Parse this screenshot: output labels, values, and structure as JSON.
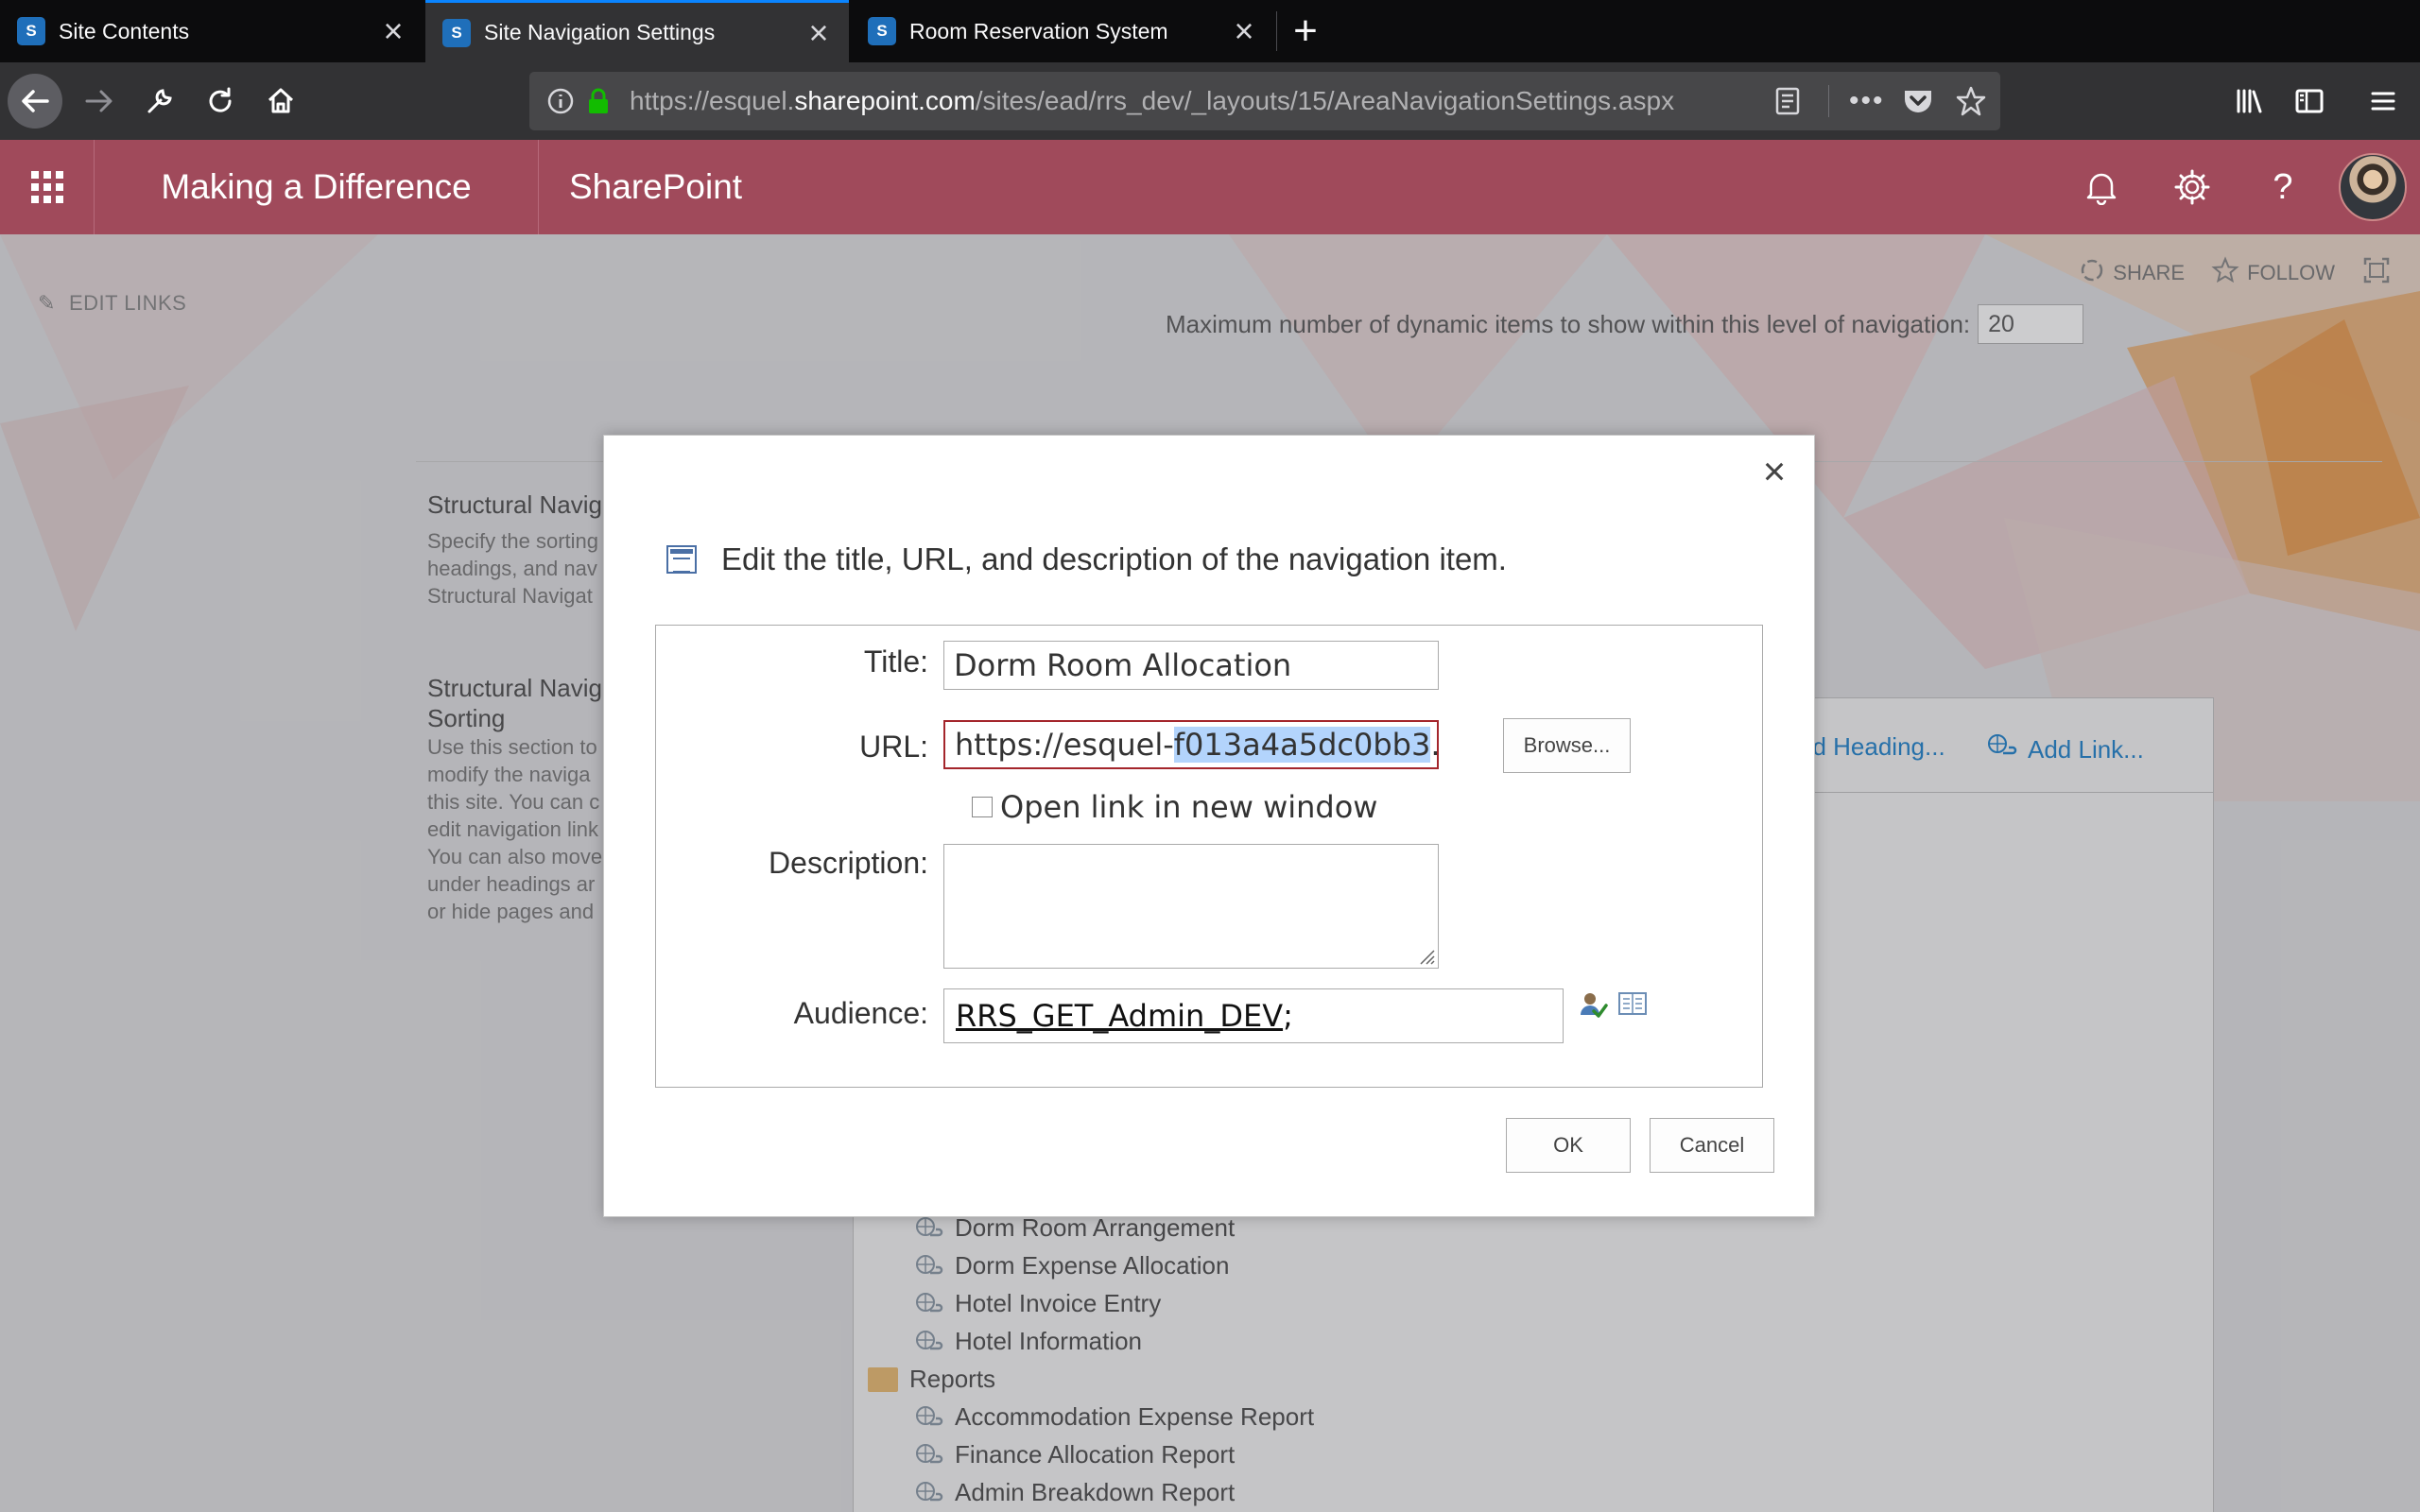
{
  "browser": {
    "tabs": [
      {
        "title": "Site Contents",
        "favicon": "sharepoint-icon"
      },
      {
        "title": "Site Navigation Settings",
        "favicon": "sharepoint-icon"
      },
      {
        "title": "Room Reservation System",
        "favicon": "sharepoint-icon"
      }
    ],
    "url": {
      "prefix": "https://esquel.",
      "domain": "sharepoint.com",
      "path": "/sites/ead/rrs_dev/_layouts/15/AreaNavigationSettings.aspx"
    },
    "accent": "#0a84ff"
  },
  "suitebar": {
    "site_name": "Making a Difference",
    "app_name": "SharePoint",
    "color": "#a04a5b"
  },
  "page": {
    "share_label": "SHARE",
    "follow_label": "FOLLOW",
    "edit_links_label": "EDIT LINKS",
    "max_items_label": "Maximum number of dynamic items to show within this level of navigation:",
    "max_items_value": "20",
    "structural_nav_title": "Structural Navig",
    "structural_nav_desc": [
      "Specify the sorting",
      "headings, and nav",
      "Structural Navigat"
    ],
    "sorting_title_1": "Structural Navig",
    "sorting_title_2": "Sorting",
    "sorting_desc": [
      "Use this section to",
      "modify the naviga",
      "this site. You can c",
      "edit navigation link",
      "You can also move",
      "under headings ar",
      "or hide pages and"
    ],
    "add_heading_label": "dd Heading...",
    "add_link_label": "Add Link...",
    "tree": {
      "items": [
        {
          "label": "Dorm Room Arrangement",
          "kind": "link"
        },
        {
          "label": "Dorm Expense Allocation",
          "kind": "link"
        },
        {
          "label": "Hotel Invoice Entry",
          "kind": "link"
        },
        {
          "label": "Hotel Information",
          "kind": "link"
        },
        {
          "label": "Reports",
          "kind": "heading"
        },
        {
          "label": "Accommodation Expense Report",
          "kind": "link"
        },
        {
          "label": "Finance Allocation Report",
          "kind": "link"
        },
        {
          "label": "Admin Breakdown Report",
          "kind": "link"
        }
      ]
    }
  },
  "dialog": {
    "heading": "Edit the title, URL, and description of the navigation item.",
    "title_label": "Title:",
    "title_value": "Dorm Room Allocation",
    "url_label": "URL:",
    "url_value_pre": "https://esquel-",
    "url_value_sel": "f013a4a5dc0bb3",
    "url_value_post": ".sha",
    "browse_label": "Browse...",
    "new_window_label": "Open link in new window",
    "new_window_checked": false,
    "description_label": "Description:",
    "description_value": "",
    "audience_label": "Audience:",
    "audience_value": "RRS_GET_Admin_DEV",
    "audience_suffix": ";",
    "ok_label": "OK",
    "cancel_label": "Cancel"
  }
}
